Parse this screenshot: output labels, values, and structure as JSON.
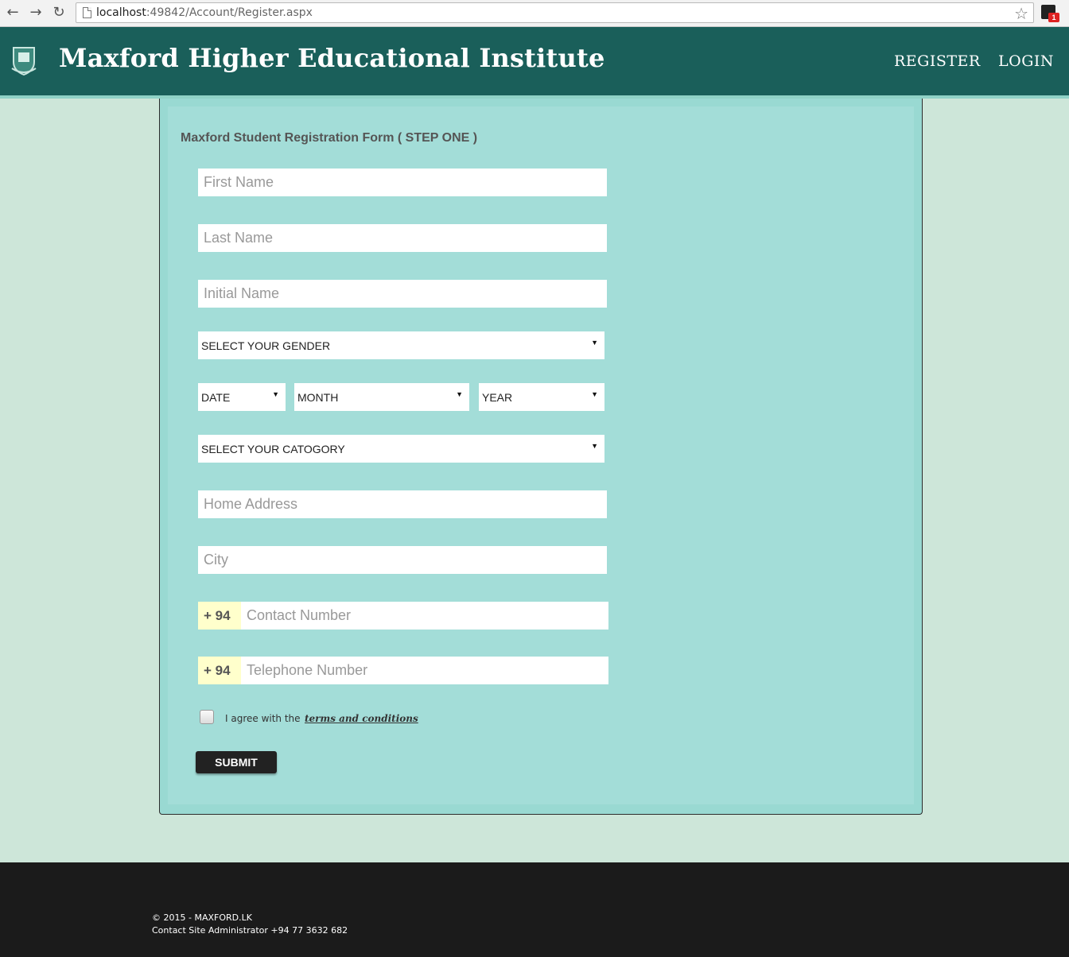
{
  "browser": {
    "url_host": "localhost",
    "url_rest": ":49842/Account/Register.aspx",
    "ext_badge": "1"
  },
  "header": {
    "title": "Maxford Higher Educational Institute",
    "nav": {
      "register": "REGISTER",
      "login": "LOGIN"
    }
  },
  "form": {
    "title": "Maxford Student Registration Form ( STEP ONE )",
    "first_name": "First Name",
    "last_name": "Last Name",
    "initial_name": "Initial Name",
    "gender": "SELECT YOUR GENDER",
    "date": "DATE",
    "month": "MONTH",
    "year": "YEAR",
    "category": "SELECT YOUR CATOGORY",
    "home_address": "Home Address",
    "city": "City",
    "contact_prefix": "+ 94",
    "contact_number": "Contact Number",
    "telephone_prefix": "+ 94",
    "telephone_number": "Telephone Number",
    "agree_text": "I agree with the",
    "terms_link": "terms and conditions",
    "submit": "SUBMIT"
  },
  "footer": {
    "copyright": "© 2015 - MAXFORD.LK",
    "contact": "Contact Site Administrator +94 77 3632 682"
  },
  "colors": {
    "header": "#1a5f5a",
    "page_bg": "#cde6d9",
    "panel": "#a3ddd8",
    "footer": "#1b1b1b",
    "prefix_bg": "#ffffcc"
  }
}
